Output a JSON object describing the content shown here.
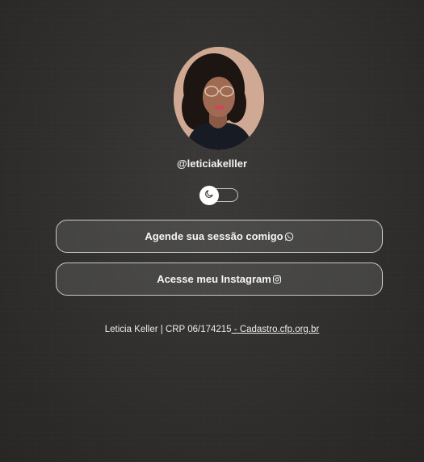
{
  "profile": {
    "handle": "@leticiakelller",
    "avatar_icon": "profile-photo"
  },
  "theme_toggle": {
    "icon": "moon-icon",
    "state": "off"
  },
  "links": [
    {
      "label": "Agende sua sessão comigo",
      "icon": "whatsapp-icon"
    },
    {
      "label": "Acesse meu Instagram",
      "icon": "instagram-icon"
    }
  ],
  "footer": {
    "text": "Leticia Keller | CRP 06/174215",
    "link_text": " - Cadastro.cfp.org.br"
  }
}
